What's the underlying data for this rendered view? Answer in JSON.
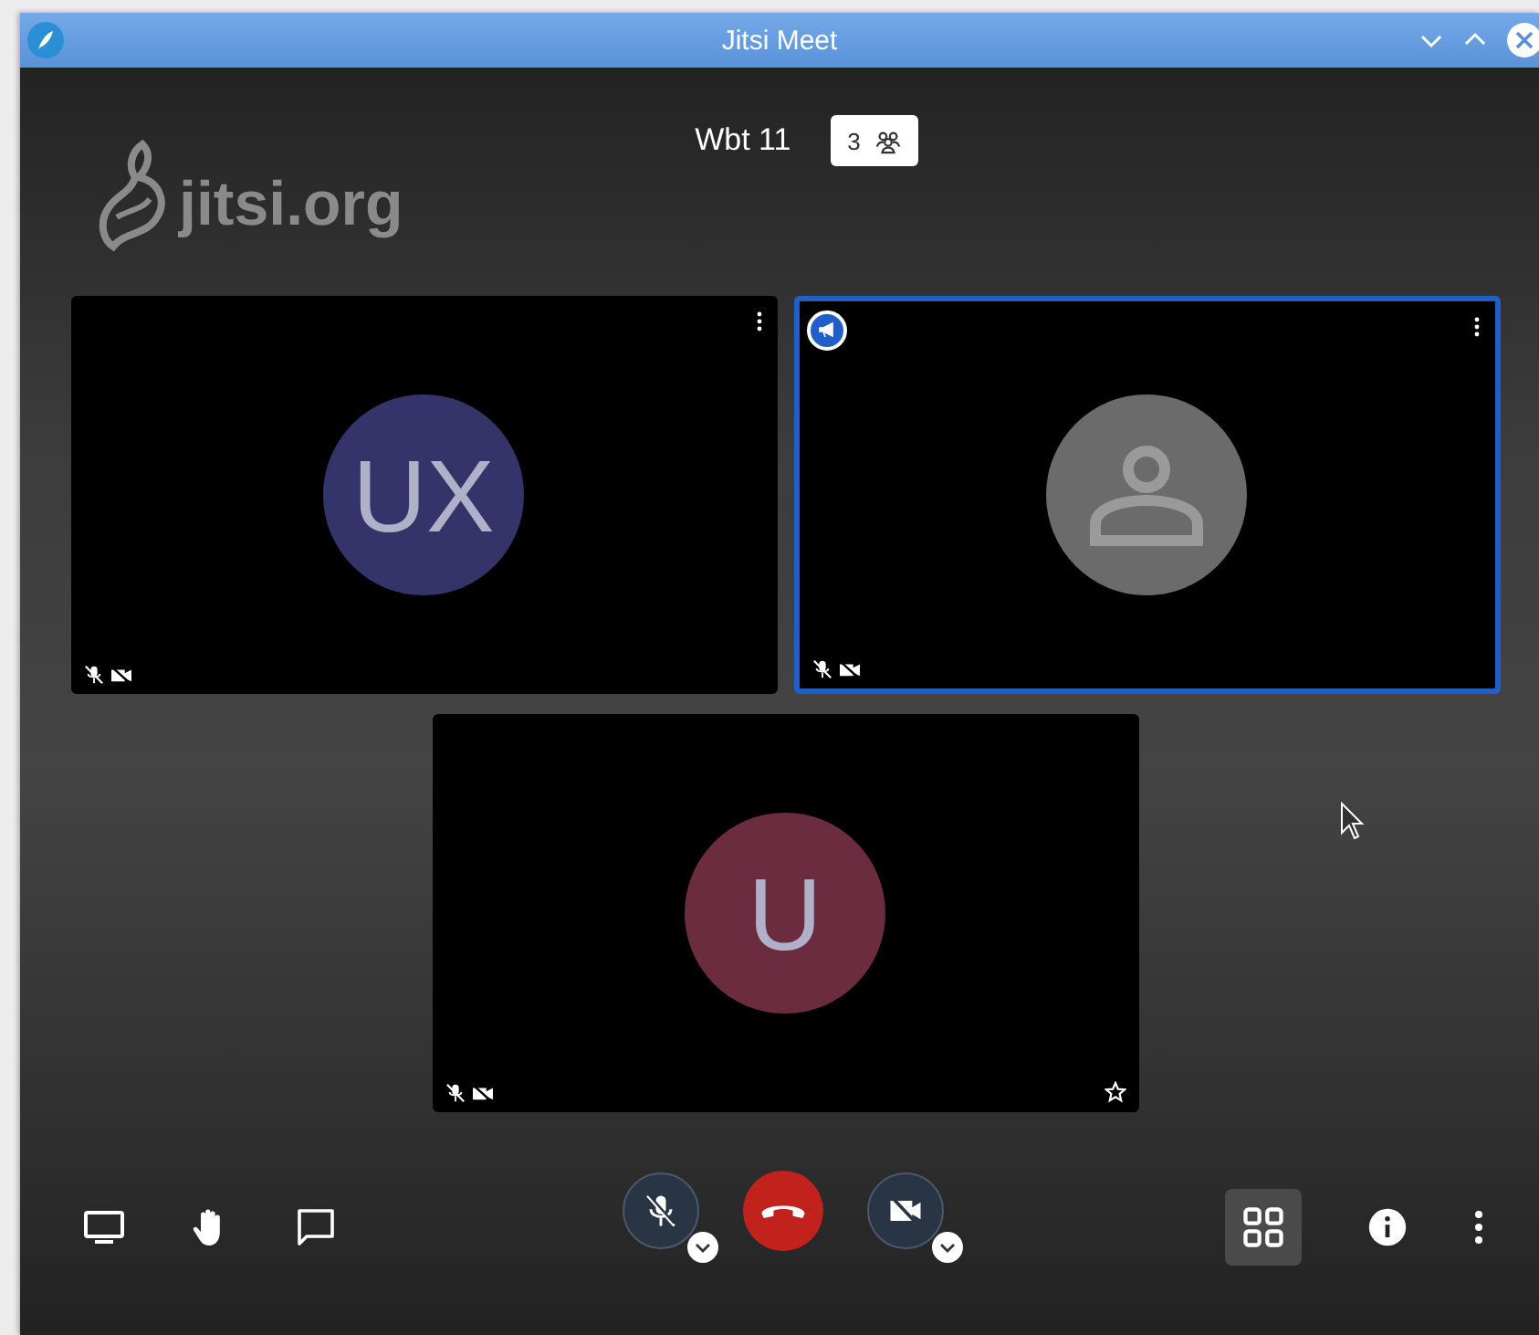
{
  "window": {
    "title": "Jitsi Meet"
  },
  "logo": {
    "text": "jitsi.org"
  },
  "header": {
    "room": "Wbt 11",
    "participant_count": "3"
  },
  "tiles": [
    {
      "kind": "initials",
      "avatar": "UX",
      "color": "#34346a",
      "speaker": false,
      "mic_muted": true,
      "video_off": true,
      "starred": false,
      "menu": true
    },
    {
      "kind": "placeholder",
      "color": "#6b6b6b",
      "speaker": true,
      "mic_muted": true,
      "video_off": true,
      "starred": false,
      "menu": true
    },
    {
      "kind": "initials",
      "avatar": "U",
      "color": "#6a2c3e",
      "speaker": false,
      "mic_muted": true,
      "video_off": true,
      "starred": true,
      "menu": false
    }
  ],
  "toolbar": {
    "mic_muted": true,
    "camera_off": true,
    "tile_view": {
      "selected": true
    }
  }
}
